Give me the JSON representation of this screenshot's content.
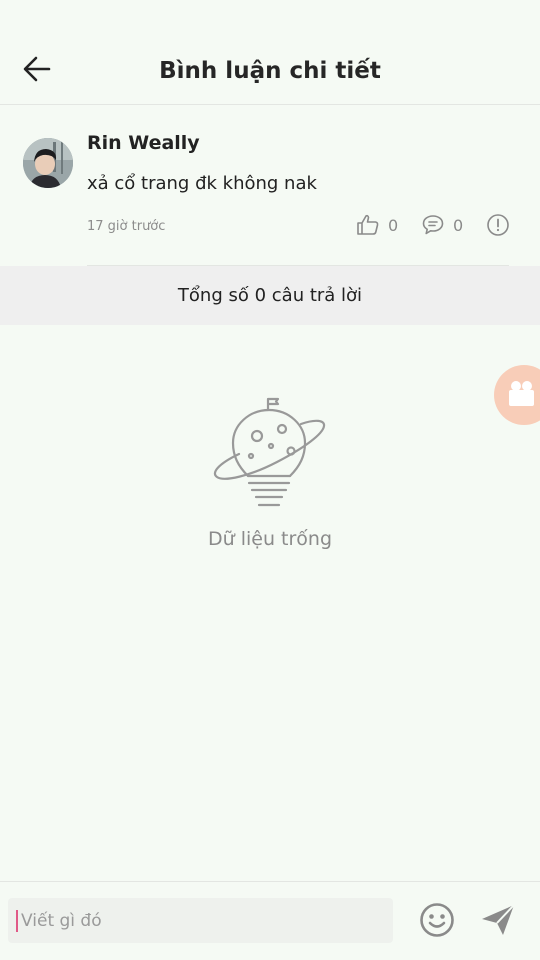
{
  "header": {
    "title": "Bình luận chi tiết",
    "back_icon": "arrow-left-icon"
  },
  "comment": {
    "author": "Rin Weally",
    "text": "xả cổ trang đk không nak",
    "time": "17 giờ trước",
    "likes": "0",
    "replies": "0",
    "icons": [
      "thumbs-up-icon",
      "comment-bubble-icon",
      "report-icon"
    ]
  },
  "replies_summary": "Tổng số 0 câu trả lời",
  "empty_state": {
    "text": "Dữ liệu trống",
    "icon": "planet-lightbulb-icon"
  },
  "floating_button": {
    "icon": "video-camera-icon",
    "color": "#f8cdb8"
  },
  "composer": {
    "placeholder": "Viết gì đó",
    "value": "",
    "emoji_icon": "smiley-icon",
    "send_icon": "send-icon"
  },
  "colors": {
    "background": "#f5faf4",
    "caret": "#e05a87",
    "icon_gray": "#8a8a8a"
  }
}
